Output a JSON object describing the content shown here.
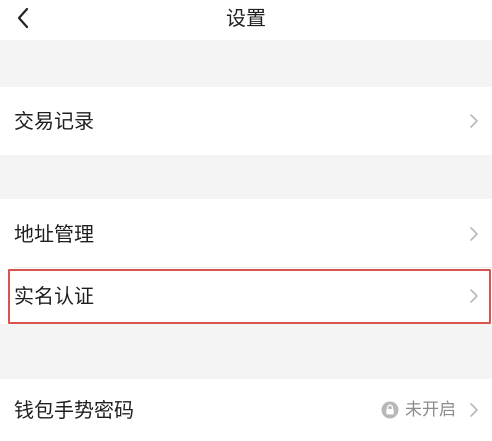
{
  "header": {
    "title": "设置"
  },
  "settings": {
    "items": [
      {
        "label": "交易记录"
      },
      {
        "label": "地址管理"
      },
      {
        "label": "实名认证"
      },
      {
        "label": "钱包手势密码",
        "status": "未开启"
      }
    ]
  },
  "colors": {
    "background": "#f4f4f4",
    "surface": "#ffffff",
    "highlight_border": "#d9534f",
    "secondary_text": "#8c8c8c"
  },
  "icons": {
    "back": "chevron-left-icon",
    "row_arrow": "chevron-right-icon",
    "lock": "lock-icon"
  }
}
